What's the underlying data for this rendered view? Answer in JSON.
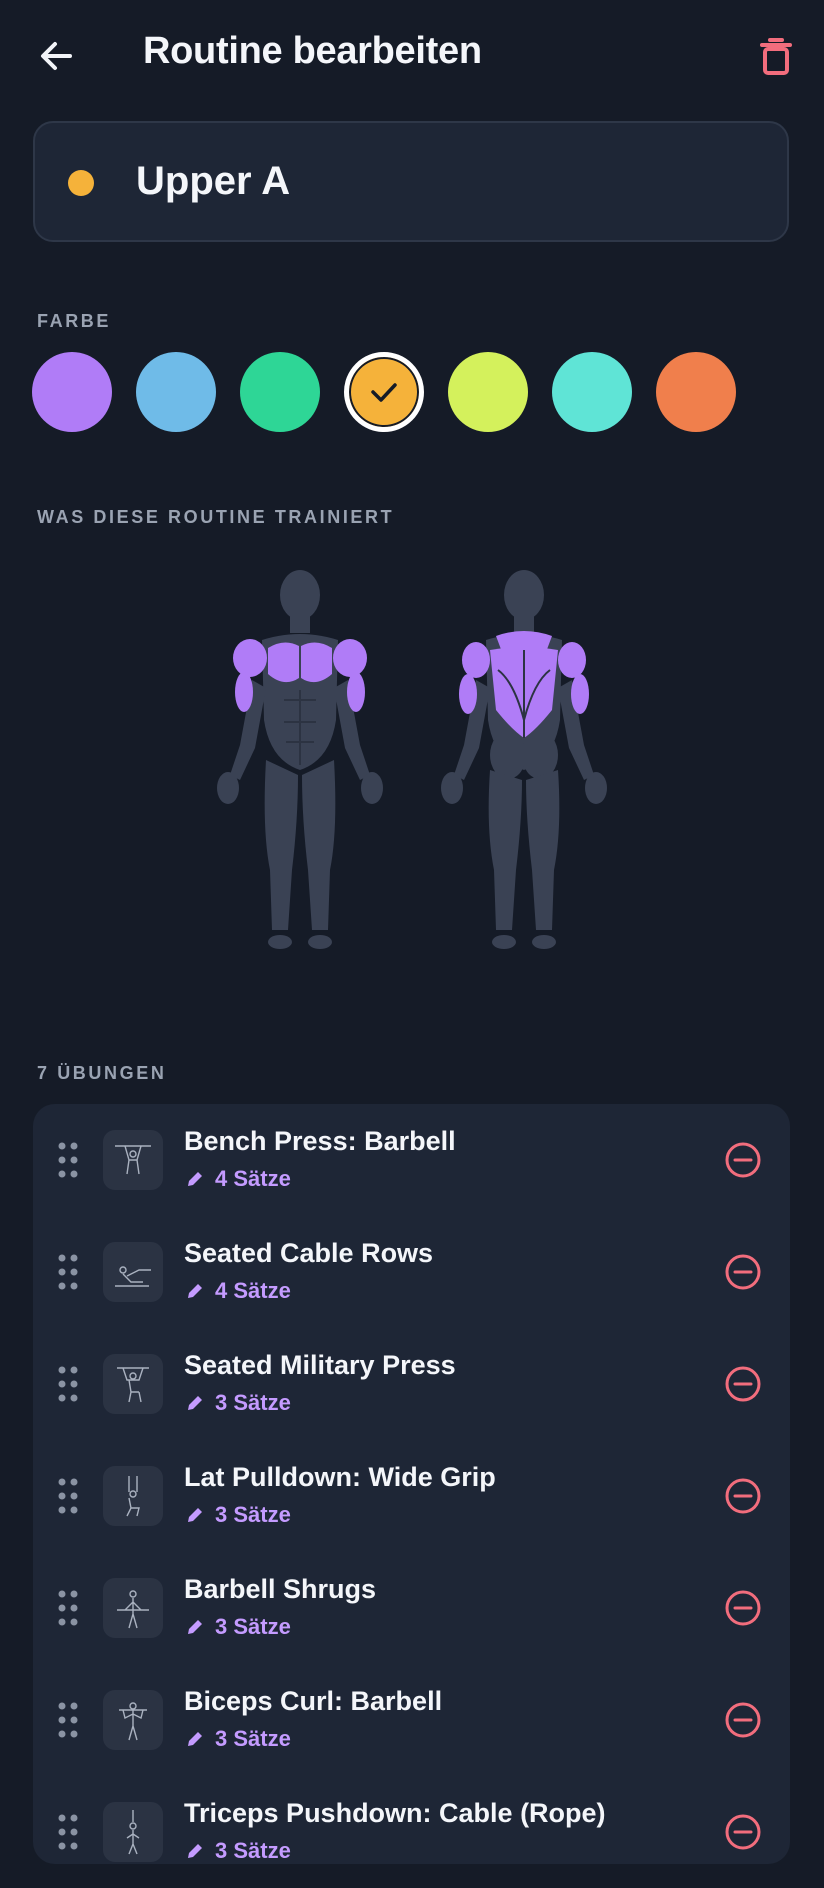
{
  "header": {
    "title": "Routine bearbeiten",
    "back_icon": "arrow-left-icon",
    "delete_icon": "trash-icon",
    "delete_color": "#f26d7d"
  },
  "routine": {
    "name": "Upper A",
    "color": "#f5b23a"
  },
  "color_section": {
    "label": "FARBE",
    "options": [
      {
        "color": "#b07cf7",
        "selected": false
      },
      {
        "color": "#6fbbe8",
        "selected": false
      },
      {
        "color": "#2ed696",
        "selected": false
      },
      {
        "color": "#f5b23a",
        "selected": true
      },
      {
        "color": "#d4f15c",
        "selected": false
      },
      {
        "color": "#5fe4d6",
        "selected": false
      },
      {
        "color": "#f07f4c",
        "selected": false
      }
    ]
  },
  "muscles_section": {
    "label": "WAS DIESE ROUTINE TRAINIERT",
    "highlight_color": "#b07cf7",
    "base_color": "#3a4254",
    "highlighted_front": [
      "shoulders",
      "chest",
      "biceps"
    ],
    "highlighted_back": [
      "traps",
      "lats",
      "rear-delts",
      "triceps"
    ]
  },
  "exercises_section": {
    "label": "7 ÜBUNGEN",
    "items": [
      {
        "name": "Bench Press: Barbell",
        "sets": "4 Sätze"
      },
      {
        "name": "Seated Cable Rows",
        "sets": "4 Sätze"
      },
      {
        "name": "Seated Military Press",
        "sets": "3 Sätze"
      },
      {
        "name": "Lat Pulldown: Wide Grip",
        "sets": "3 Sätze"
      },
      {
        "name": "Barbell Shrugs",
        "sets": "3 Sätze"
      },
      {
        "name": "Biceps Curl: Barbell",
        "sets": "3 Sätze"
      },
      {
        "name": "Triceps Pushdown: Cable (Rope)",
        "sets": "3 Sätze"
      }
    ],
    "edit_icon": "pencil-icon",
    "remove_icon": "minus-circle-icon",
    "drag_icon": "drag-handle-icon"
  }
}
